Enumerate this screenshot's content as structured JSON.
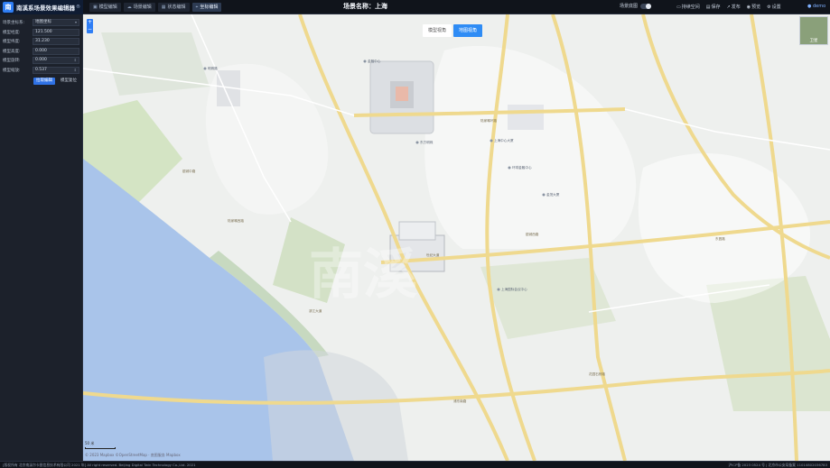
{
  "app": {
    "title": "南溪系场景效果编辑器",
    "badge": "®",
    "logo_text": "南"
  },
  "tabs": [
    {
      "label": "模型编辑",
      "icon": "cube-icon",
      "active": false
    },
    {
      "label": "场景编辑",
      "icon": "cloud-icon",
      "active": false
    },
    {
      "label": "状态编辑",
      "icon": "grid-icon",
      "active": false
    },
    {
      "label": "坐标编辑",
      "icon": "crosshair-icon",
      "active": true
    }
  ],
  "scene": {
    "title": "场景名称：上海"
  },
  "toolbar": {
    "toggle_label": "场景底图",
    "actions": [
      {
        "label": "持续空间",
        "icon": "monitor-icon"
      },
      {
        "label": "保存",
        "icon": "save-icon"
      },
      {
        "label": "发布",
        "icon": "share-icon"
      },
      {
        "label": "预览",
        "icon": "eye-icon"
      },
      {
        "label": "设置",
        "icon": "gear-icon"
      }
    ],
    "user": "demo"
  },
  "panel": {
    "fields": [
      {
        "label": "场景坐标系:",
        "value": "地图坐标",
        "type": "select"
      },
      {
        "label": "模型经度:",
        "value": "121.500",
        "type": "input"
      },
      {
        "label": "模型纬度:",
        "value": "31.230",
        "type": "input"
      },
      {
        "label": "模型高度:",
        "value": "0.000",
        "type": "input"
      },
      {
        "label": "模型旋转:",
        "value": "0.000",
        "type": "stepper"
      },
      {
        "label": "模型缩放:",
        "value": "0.537",
        "type": "stepper"
      }
    ],
    "apply_label": "拉取编辑",
    "reset_label": "模型复位"
  },
  "map": {
    "zoom_in": "+",
    "zoom_out": "−",
    "view_model": "模型视角",
    "view_map": "地图视角",
    "thumb_label": "卫星",
    "scale_label": "50 米",
    "attribution": "© 2023 Mapbox ©OpenStreetMap · 底图服务 Mapbox",
    "watermark": "南溪",
    "labels": [
      "明珠路",
      "金融中心",
      "陆家嘴环路",
      "东方明珠",
      "银城中路",
      "世纪大道",
      "上海中心大厦",
      "环球金融中心",
      "金茂大厦",
      "滨江大道",
      "银城西路",
      "花园石桥路",
      "陆家嘴西路",
      "浦东南路",
      "东昌路",
      "上海国际会议中心"
    ]
  },
  "footer": {
    "left": "[版权所有 北京南溪尔卡图信息技术有限公司 2021 年] All right reserved. Beijing Digital Twin Technology Co.,Ltd. 2021",
    "right": "沪ICP备 2023 0524 号 | 北京市公安局备案 11010802036783"
  }
}
